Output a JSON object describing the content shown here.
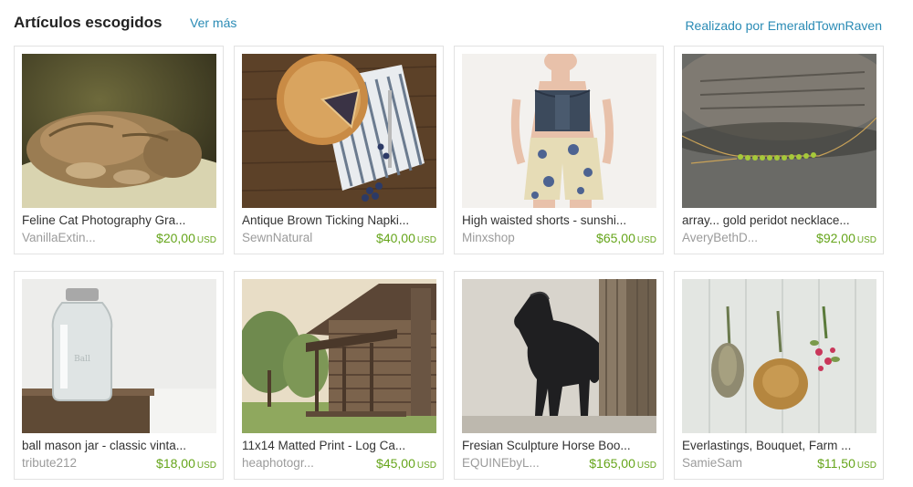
{
  "header": {
    "title": "Artículos escogidos",
    "see_more": "Ver más",
    "curated_by": "Realizado por EmeraldTownRaven"
  },
  "items": [
    {
      "title": "Feline Cat Photography Gra...",
      "seller": "VanillaExtin...",
      "price": "$20,00",
      "currency": "USD",
      "image": "sleeping-cat-photo"
    },
    {
      "title": "Antique Brown Ticking Napki...",
      "seller": "SewnNatural",
      "price": "$40,00",
      "currency": "USD",
      "image": "pie-on-napkin-photo"
    },
    {
      "title": "High waisted shorts - sunshi...",
      "seller": "Minxshop",
      "price": "$65,00",
      "currency": "USD",
      "image": "floral-shorts-photo"
    },
    {
      "title": "array... gold peridot necklace...",
      "seller": "AveryBethD...",
      "price": "$92,00",
      "currency": "USD",
      "image": "peridot-necklace-photo"
    },
    {
      "title": "ball mason jar - classic vinta...",
      "seller": "tribute212",
      "price": "$18,00",
      "currency": "USD",
      "image": "mason-jar-photo"
    },
    {
      "title": "11x14 Matted Print - Log Ca...",
      "seller": "heaphotogr...",
      "price": "$45,00",
      "currency": "USD",
      "image": "log-cabin-photo"
    },
    {
      "title": "Fresian Sculpture Horse Boo...",
      "seller": "EQUINEbyL...",
      "price": "$165,00",
      "currency": "USD",
      "image": "horse-bookend-photo"
    },
    {
      "title": "Everlastings, Bouquet, Farm ...",
      "seller": "SamieSam",
      "price": "$11,50",
      "currency": "USD",
      "image": "dried-bouquets-photo"
    }
  ]
}
